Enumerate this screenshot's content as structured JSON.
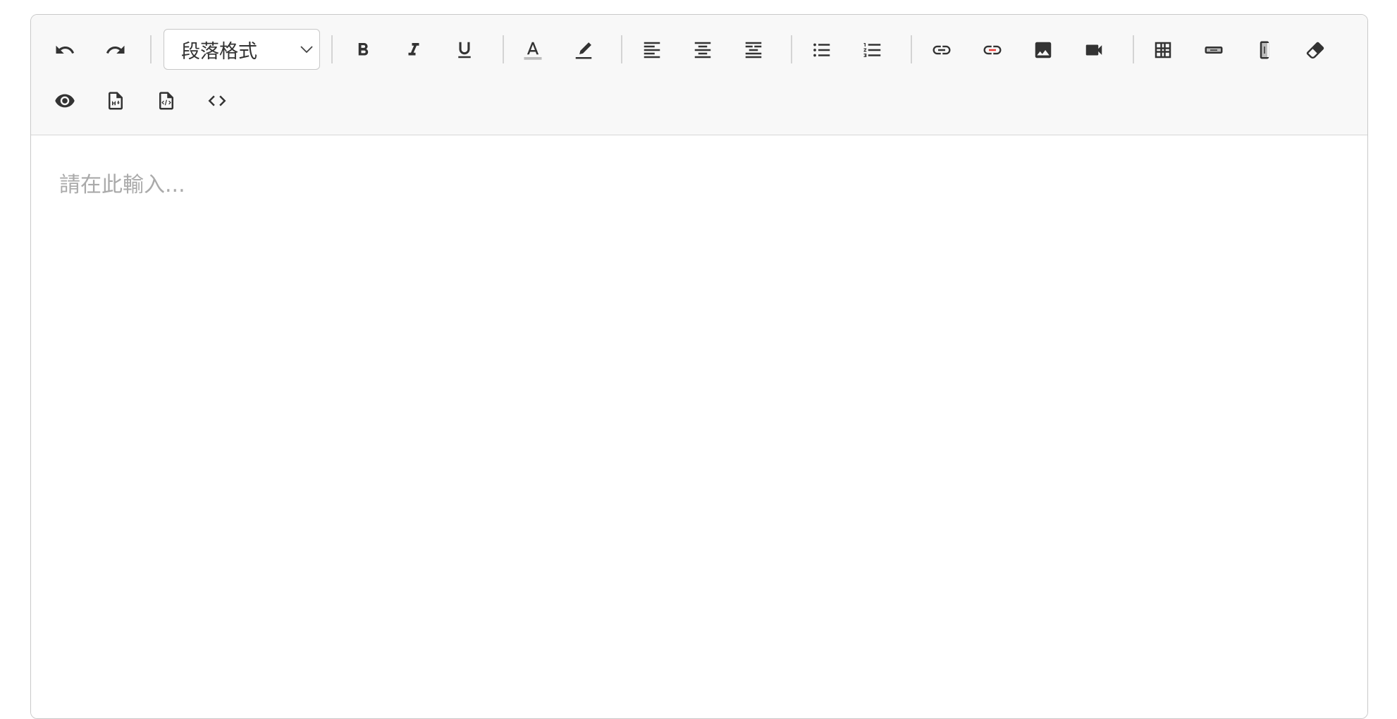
{
  "toolbar": {
    "paragraph_format": {
      "selected": "段落格式"
    },
    "buttons": [
      {
        "name": "undo-button",
        "icon": "undo-icon"
      },
      {
        "name": "redo-button",
        "icon": "redo-icon"
      },
      {
        "name": "bold-button",
        "icon": "bold-icon"
      },
      {
        "name": "italic-button",
        "icon": "italic-icon"
      },
      {
        "name": "underline-button",
        "icon": "underline-icon"
      },
      {
        "name": "font-color-button",
        "icon": "font-color-icon"
      },
      {
        "name": "highlight-button",
        "icon": "highlighter-icon"
      },
      {
        "name": "align-left-button",
        "icon": "align-left-icon"
      },
      {
        "name": "align-center-button",
        "icon": "align-center-icon"
      },
      {
        "name": "indent-button",
        "icon": "indent-icon"
      },
      {
        "name": "bullet-list-button",
        "icon": "bullet-list-icon"
      },
      {
        "name": "numbered-list-button",
        "icon": "numbered-list-icon"
      },
      {
        "name": "insert-link-button",
        "icon": "link-icon"
      },
      {
        "name": "remove-link-button",
        "icon": "unlink-icon"
      },
      {
        "name": "insert-image-button",
        "icon": "image-icon"
      },
      {
        "name": "insert-video-button",
        "icon": "video-icon"
      },
      {
        "name": "insert-table-button",
        "icon": "table-icon"
      },
      {
        "name": "insert-row-button",
        "icon": "row-icon"
      },
      {
        "name": "insert-column-button",
        "icon": "column-icon"
      },
      {
        "name": "clear-format-button",
        "icon": "eraser-icon"
      },
      {
        "name": "preview-button",
        "icon": "eye-icon"
      },
      {
        "name": "markdown-button",
        "icon": "markdown-file-icon"
      },
      {
        "name": "html-file-button",
        "icon": "code-file-icon"
      },
      {
        "name": "source-code-button",
        "icon": "code-icon"
      }
    ]
  },
  "editor": {
    "placeholder": "請在此輸入..."
  },
  "colors": {
    "toolbar_bg": "#f8f8f8",
    "icon": "#333333",
    "placeholder": "#aaaaaa",
    "unlink_accent": "#e53935",
    "font_color_bar": "#bdbdbd"
  }
}
